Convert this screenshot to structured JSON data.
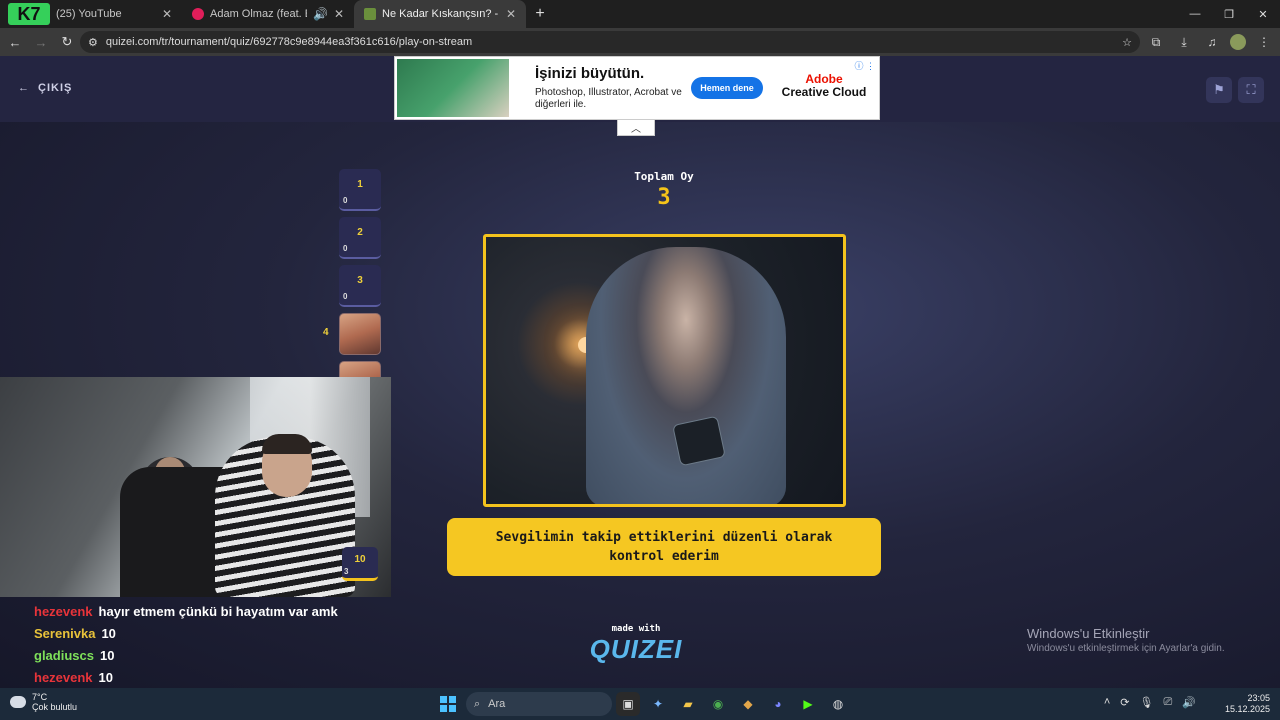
{
  "browser": {
    "tabs": [
      {
        "title": "(25) YouTube",
        "favicon_color": "#ff0000",
        "active": false
      },
      {
        "title": "Adam Olmaz (feat. Eypio, C",
        "favicon_color": "#e01e5a",
        "active": false
      },
      {
        "title": "Ne Kadar Kıskançsın? - Tier List",
        "favicon_color": "#6a8f3c",
        "active": true
      }
    ],
    "overlay_logo": "K7",
    "url": "quizei.com/tr/tournament/quiz/692778c9e8944ea3f361c616/play-on-stream"
  },
  "page": {
    "exit_label": "ÇIKIŞ",
    "ad": {
      "headline": "İşinizi büyütün.",
      "body": "Photoshop, Illustrator, Acrobat ve diğerleri ile.",
      "button": "Hemen dene",
      "brand_line1": "Adobe",
      "brand_line2": "Creative Cloud"
    },
    "tier_slots": [
      {
        "number": "1",
        "votes": "0"
      },
      {
        "number": "2",
        "votes": "0"
      },
      {
        "number": "3",
        "votes": "0"
      }
    ],
    "slot_4_label": "4",
    "total_votes_label": "Toplam Oy",
    "total_votes_value": "3",
    "statement": "Sevgilimin takip ettiklerini düzenli olarak kontrol ederim",
    "made_with": "made with",
    "brand": "QUIZEI",
    "bottom_slot": {
      "number": "10",
      "votes": "3"
    }
  },
  "chat": [
    {
      "user": "hezevenk",
      "color": "#e8343a",
      "message": "hayır etmem çünkü bi hayatım var amk"
    },
    {
      "user": "Serenivka",
      "color": "#e8c23a",
      "message": "10"
    },
    {
      "user": "gladiuscs",
      "color": "#7ee05a",
      "message": "10"
    },
    {
      "user": "hezevenk",
      "color": "#e8343a",
      "message": "10"
    }
  ],
  "windows_activation": {
    "title": "Windows'u Etkinleştir",
    "subtitle": "Windows'u etkinleştirmek için Ayarlar'a gidin."
  },
  "taskbar": {
    "weather_temp": "7°C",
    "weather_desc": "Çok bulutlu",
    "search_placeholder": "Ara",
    "time": "23:05",
    "date": "15.12.2025"
  }
}
